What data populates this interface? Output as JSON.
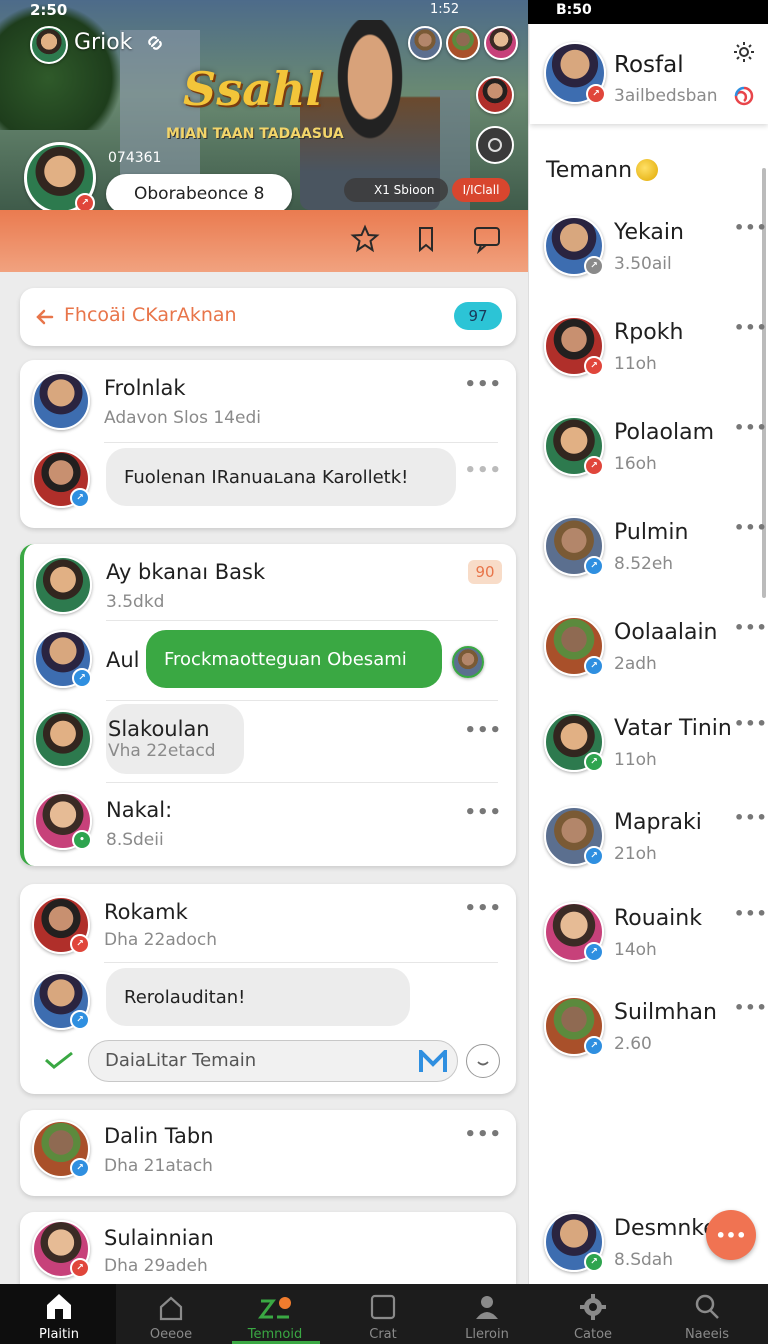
{
  "status_left": {
    "time": "2:50"
  },
  "status_right": {
    "time": "B:50",
    "battery": "1:52"
  },
  "header": {
    "user_name": "Griok",
    "game_title": "Ssahl",
    "game_subtitle": "MIAN TAAN TADAASUA",
    "profile_id": "074361",
    "profile_status": "Oborabeonce 8",
    "tag_level": "X1 Sbioon",
    "tag_chat": "I/IClall"
  },
  "search": {
    "label": "Fhcoäi CKarAknan",
    "badge": "97"
  },
  "chats": {
    "c1": {
      "name": "Frolnlak",
      "sub": "Adavon Slos 14edi",
      "bubble": "Fuolenan IRanuaʟana Karolletk!"
    },
    "c2": {
      "name": "Ay bkanaı Bask",
      "sub": "3.5dkd",
      "badge": "90",
      "prefix": "Aul",
      "bubble": "Frockmaotteguan Obesami"
    },
    "c3": {
      "name": "Slakoulan",
      "sub": "Vha 22etacd"
    },
    "c4": {
      "name": "Nakal:",
      "sub": "8.Sdeii"
    },
    "c5": {
      "name": "Rokamk",
      "sub": "Dha 22adoch",
      "bubble": "Rerolauditan!",
      "input_placeholder": "DaiaLitar Temain"
    },
    "c6": {
      "name": "Dalin Tabn",
      "sub": "Dha 21atach"
    },
    "c7": {
      "name": "Sulainnian",
      "sub": "Dha 29adeh"
    }
  },
  "right_panel": {
    "profile_name": "Rosfal",
    "profile_sub": "3ailbedsban",
    "section_title": "Temann",
    "friends": [
      {
        "name": "Yekain",
        "sub": "3.50ail"
      },
      {
        "name": "Rpokh",
        "sub": "11oh"
      },
      {
        "name": "Polaolam",
        "sub": "16oh"
      },
      {
        "name": "Pulmin",
        "sub": "8.52eh"
      },
      {
        "name": "Oolaalain",
        "sub": "2adh"
      },
      {
        "name": "Vatar Tinin",
        "sub": "11oh"
      },
      {
        "name": "Mapraki",
        "sub": "21oh"
      },
      {
        "name": "Rouaink",
        "sub": "14oh"
      },
      {
        "name": "Suilmhan",
        "sub": "2.60"
      },
      {
        "name": "Desmnker",
        "sub": "8.Sdah"
      }
    ]
  },
  "nav": {
    "home": "Plaitin",
    "n2": "Oeeoe",
    "n3": "Temnoid",
    "n4": "Crat",
    "n5": "Lleroin",
    "n6": "Catoe",
    "n7": "Naeeis"
  },
  "colors": {
    "accent_orange": "#e8754a",
    "green": "#3aa843",
    "teal": "#2cc4d6",
    "nav_bg": "#1c1c1c"
  }
}
